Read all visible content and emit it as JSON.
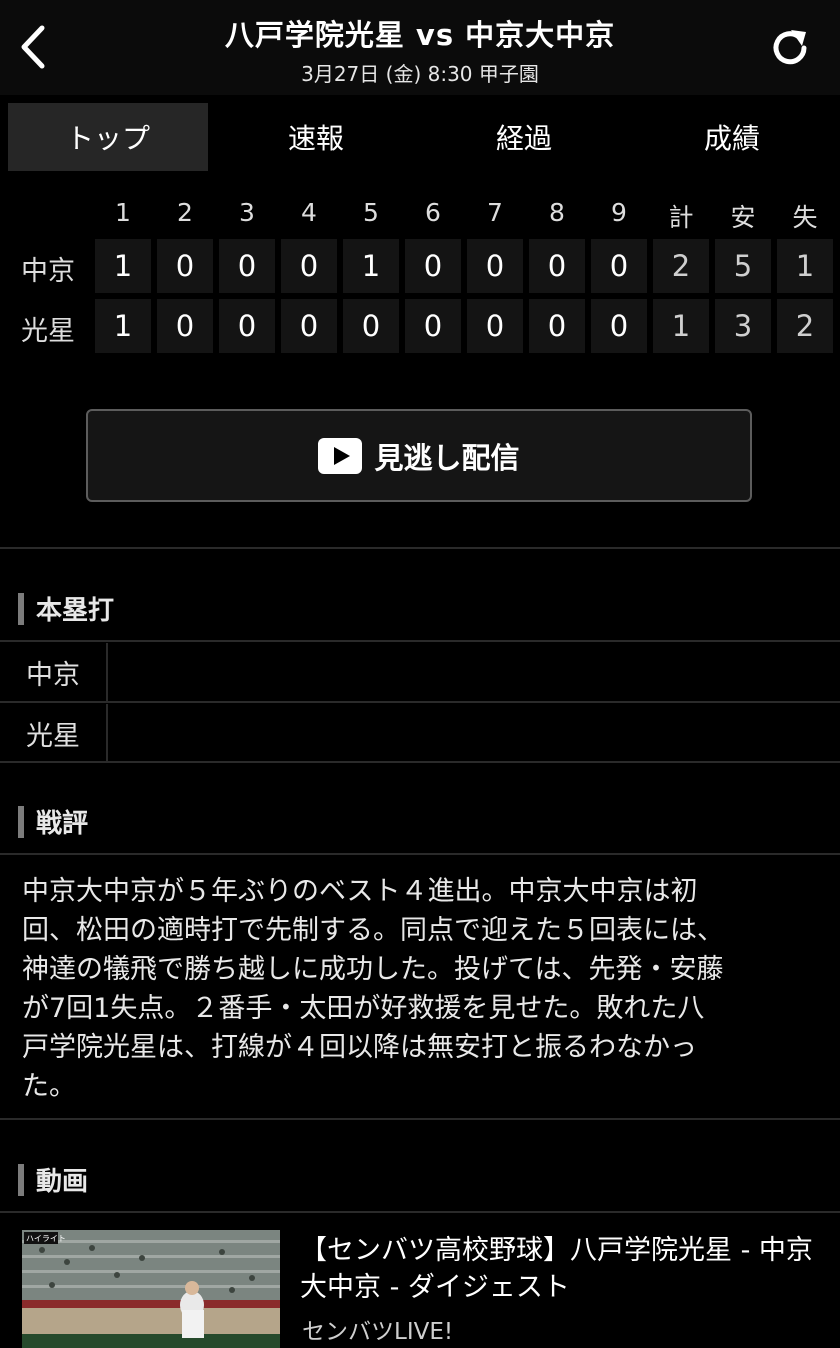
{
  "header": {
    "title": "八戸学院光星 vs 中京大中京",
    "subtitle": "3月27日 (金) 8:30 甲子園"
  },
  "tabs": [
    {
      "label": "トップ",
      "active": true
    },
    {
      "label": "速報",
      "active": false
    },
    {
      "label": "経過",
      "active": false
    },
    {
      "label": "成績",
      "active": false
    }
  ],
  "scoreboard": {
    "columns": [
      "1",
      "2",
      "3",
      "4",
      "5",
      "6",
      "7",
      "8",
      "9",
      "計",
      "安",
      "失"
    ],
    "rows": [
      {
        "team": "中京",
        "values": [
          "1",
          "0",
          "0",
          "0",
          "1",
          "0",
          "0",
          "0",
          "0",
          "2",
          "5",
          "1"
        ]
      },
      {
        "team": "光星",
        "values": [
          "1",
          "0",
          "0",
          "0",
          "0",
          "0",
          "0",
          "0",
          "0",
          "1",
          "3",
          "2"
        ]
      }
    ]
  },
  "replay_button": {
    "label": "見逃し配信"
  },
  "home_runs": {
    "heading": "本塁打",
    "rows": [
      {
        "team": "中京",
        "value": ""
      },
      {
        "team": "光星",
        "value": ""
      }
    ]
  },
  "review": {
    "heading": "戦評",
    "lines": [
      "中京大中京が５年ぶりのベスト４進出。中京大中京は初",
      "回、松田の適時打で先制する。同点で迎えた５回表には、",
      "神達の犠飛で勝ち越しに成功した。投げては、先発・安藤",
      "が7回1失点。２番手・太田が好救援を見せた。敗れた八",
      "戸学院光星は、打線が４回以降は無安打と振るわなかっ",
      "た。"
    ]
  },
  "videos": {
    "heading": "動画",
    "items": [
      {
        "title_lines": [
          "【センバツ高校野球】八戸学院光星 - 中京",
          "大中京 - ダイジェスト"
        ],
        "source": "センバツLIVE!",
        "badge": "ハイライト"
      }
    ]
  },
  "icons": {
    "back": "chevron-left-icon",
    "refresh": "refresh-icon",
    "play": "play-icon"
  }
}
